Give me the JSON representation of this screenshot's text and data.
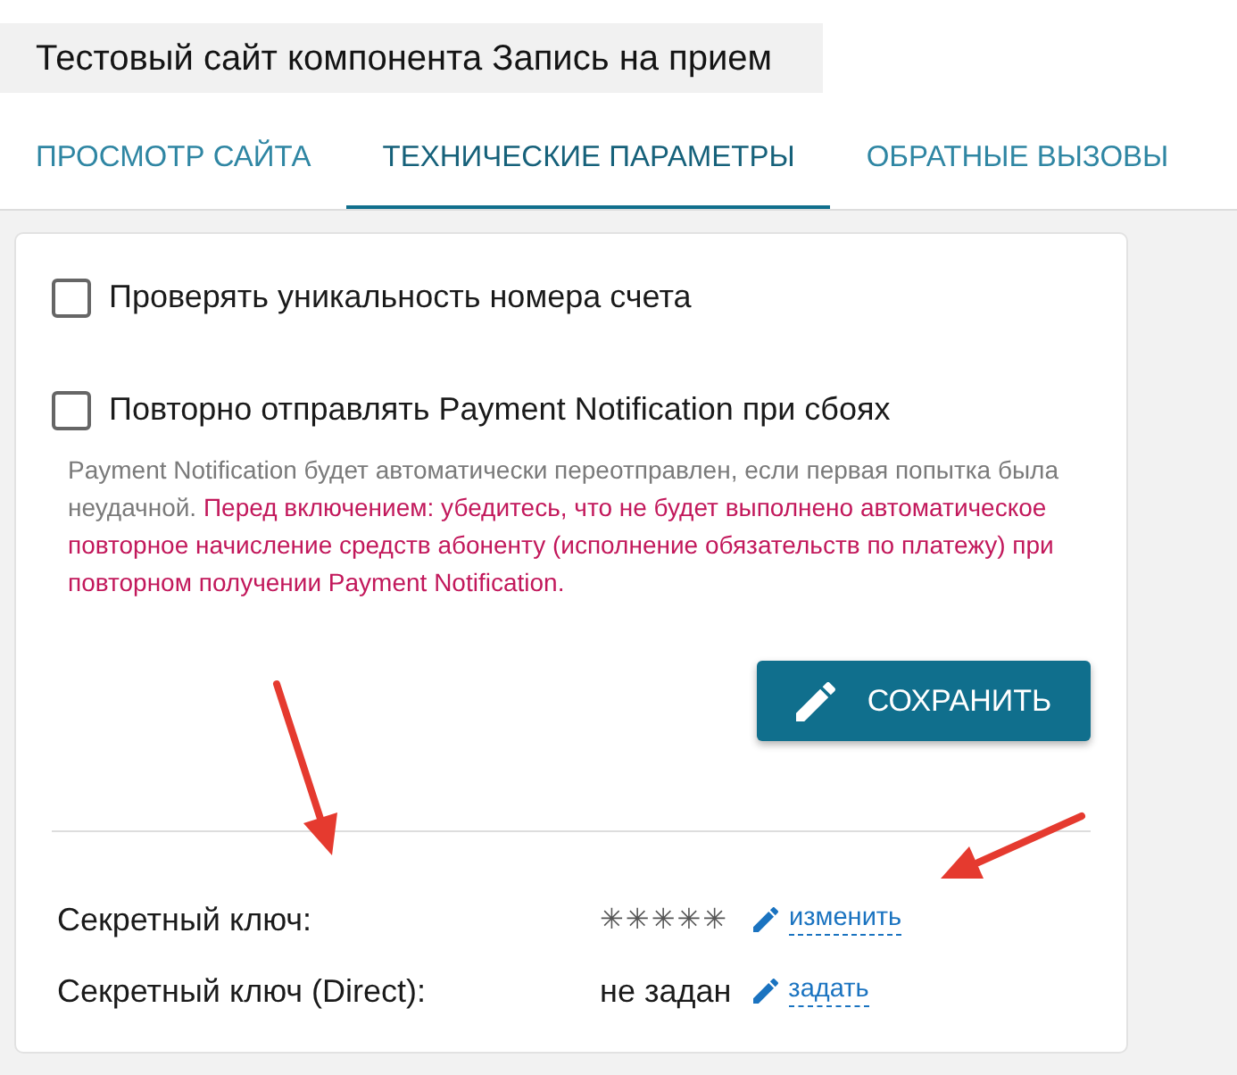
{
  "title": "Тестовый сайт компонента Запись на прием",
  "tabs": [
    {
      "label": "ПРОСМОТР САЙТА",
      "selected": false
    },
    {
      "label": "ТЕХНИЧЕСКИЕ ПАРАМЕТРЫ",
      "selected": true
    },
    {
      "label": "ОБРАТНЫЕ ВЫЗОВЫ",
      "selected": false
    }
  ],
  "options": [
    {
      "label": "Проверять уникальность номера счета",
      "checked": false
    },
    {
      "label": "Повторно отправлять Payment Notification при сбоях",
      "checked": false,
      "note": {
        "text": "Payment Notification будет автоматически переотправлен, если первая попытка была неудачной.",
        "warning": "Перед включением: убедитесь, что не будет выполнено автоматическое повторное начисление средств абоненту (исполнение обязательств по платежу) при повторном получении Payment Notification."
      }
    }
  ],
  "save_button": {
    "label": "СОХРАНИТЬ"
  },
  "keys": [
    {
      "label": "Секретный ключ:",
      "kind": "masked",
      "value": "✳✳✳✳✳",
      "action": "изменить"
    },
    {
      "label": "Секретный ключ (Direct):",
      "kind": "plain",
      "value": "не задан",
      "action": "задать"
    }
  ]
}
